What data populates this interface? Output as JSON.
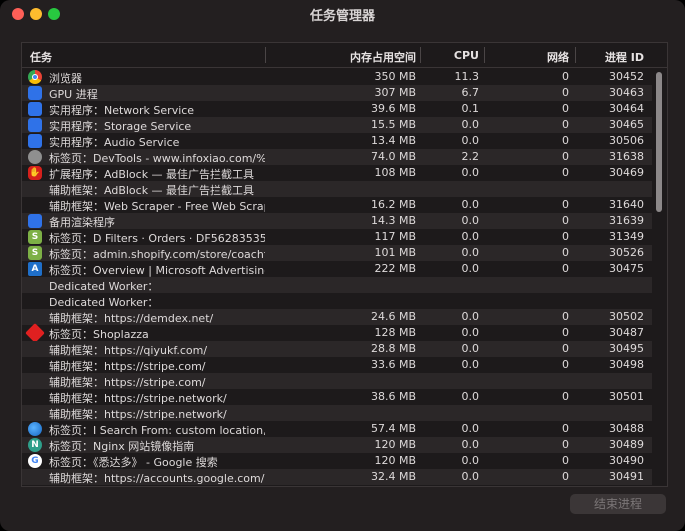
{
  "window": {
    "title": "任务管理器"
  },
  "columns": {
    "task": "任务",
    "memory": "内存占用空间",
    "cpu": "CPU",
    "network": "网络",
    "pid": "进程 ID"
  },
  "rows": [
    {
      "icon": "chrome-icon",
      "name": "浏览器",
      "memory": "350 MB",
      "cpu": "11.3",
      "network": "0",
      "pid": "30452"
    },
    {
      "icon": "puzzle-icon",
      "name": "GPU 进程",
      "memory": "307 MB",
      "cpu": "6.7",
      "network": "0",
      "pid": "30463"
    },
    {
      "icon": "puzzle-icon",
      "name": "实用程序：Network Service",
      "memory": "39.6 MB",
      "cpu": "0.1",
      "network": "0",
      "pid": "30464"
    },
    {
      "icon": "puzzle-icon",
      "name": "实用程序：Storage Service",
      "memory": "15.5 MB",
      "cpu": "0.0",
      "network": "0",
      "pid": "30465"
    },
    {
      "icon": "puzzle-icon",
      "name": "实用程序：Audio Service",
      "memory": "13.4 MB",
      "cpu": "0.0",
      "network": "0",
      "pid": "30506"
    },
    {
      "icon": "globe-icon",
      "name": "标签页：DevTools - www.infoxiao.com/%E",
      "memory": "74.0 MB",
      "cpu": "2.2",
      "network": "0",
      "pid": "31638"
    },
    {
      "icon": "adblock-icon",
      "name": "扩展程序：AdBlock — 最佳广告拦截工具",
      "memory": "108 MB",
      "cpu": "0.0",
      "network": "0",
      "pid": "30469"
    },
    {
      "icon": "",
      "name": "辅助框架：AdBlock — 最佳广告拦截工具",
      "memory": "",
      "cpu": "",
      "network": "",
      "pid": ""
    },
    {
      "icon": "",
      "name": "辅助框架：Web Scraper - Free Web Scrap",
      "memory": "16.2 MB",
      "cpu": "0.0",
      "network": "0",
      "pid": "31640"
    },
    {
      "icon": "puzzle-icon",
      "name": "备用渲染程序",
      "memory": "14.3 MB",
      "cpu": "0.0",
      "network": "0",
      "pid": "31639"
    },
    {
      "icon": "shopify-icon",
      "name": "标签页：D Filters · Orders · DF56283535",
      "memory": "117 MB",
      "cpu": "0.0",
      "network": "0",
      "pid": "31349"
    },
    {
      "icon": "shopify-icon",
      "name": "标签页：admin.shopify.com/store/coachfi",
      "memory": "101 MB",
      "cpu": "0.0",
      "network": "0",
      "pid": "30526"
    },
    {
      "icon": "ms-advertising-icon",
      "name": "标签页：Overview | Microsoft Advertising",
      "memory": "222 MB",
      "cpu": "0.0",
      "network": "0",
      "pid": "30475"
    },
    {
      "icon": "",
      "name": "Dedicated Worker：",
      "memory": "",
      "cpu": "",
      "network": "",
      "pid": ""
    },
    {
      "icon": "",
      "name": "Dedicated Worker：",
      "memory": "",
      "cpu": "",
      "network": "",
      "pid": ""
    },
    {
      "icon": "",
      "name": "辅助框架：https://demdex.net/",
      "memory": "24.6 MB",
      "cpu": "0.0",
      "network": "0",
      "pid": "30502"
    },
    {
      "icon": "shoplazza-icon",
      "name": "标签页：Shoplazza",
      "memory": "128 MB",
      "cpu": "0.0",
      "network": "0",
      "pid": "30487"
    },
    {
      "icon": "",
      "name": "辅助框架：https://qiyukf.com/",
      "memory": "28.8 MB",
      "cpu": "0.0",
      "network": "0",
      "pid": "30495"
    },
    {
      "icon": "",
      "name": "辅助框架：https://stripe.com/",
      "memory": "33.6 MB",
      "cpu": "0.0",
      "network": "0",
      "pid": "30498"
    },
    {
      "icon": "",
      "name": "辅助框架：https://stripe.com/",
      "memory": "",
      "cpu": "",
      "network": "",
      "pid": ""
    },
    {
      "icon": "",
      "name": "辅助框架：https://stripe.network/",
      "memory": "38.6 MB",
      "cpu": "0.0",
      "network": "0",
      "pid": "30501"
    },
    {
      "icon": "",
      "name": "辅助框架：https://stripe.network/",
      "memory": "",
      "cpu": "",
      "network": "",
      "pid": ""
    },
    {
      "icon": "search-globe-icon",
      "name": "标签页：I Search From: custom location, l",
      "memory": "57.4 MB",
      "cpu": "0.0",
      "network": "0",
      "pid": "30488"
    },
    {
      "icon": "nginx-icon",
      "name": "标签页：Nginx 网站镜像指南",
      "memory": "120 MB",
      "cpu": "0.0",
      "network": "0",
      "pid": "30489"
    },
    {
      "icon": "google-icon",
      "name": "标签页：《悉达多》 - Google 搜索",
      "memory": "120 MB",
      "cpu": "0.0",
      "network": "0",
      "pid": "30490"
    },
    {
      "icon": "",
      "name": "辅助框架：https://accounts.google.com/",
      "memory": "32.4 MB",
      "cpu": "0.0",
      "network": "0",
      "pid": "30491"
    }
  ],
  "footer": {
    "end_process_label": "结束进程"
  }
}
